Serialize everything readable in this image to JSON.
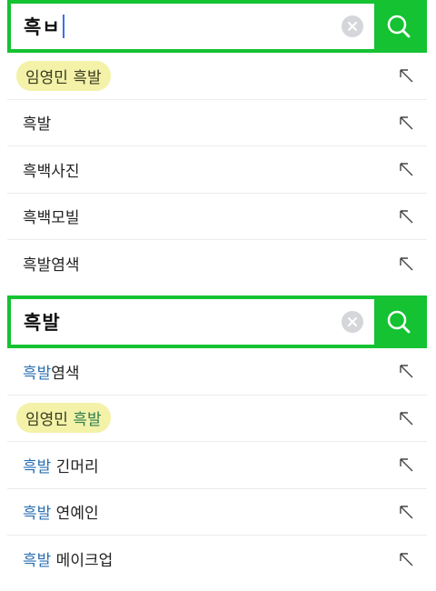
{
  "panels": [
    {
      "query": "흑ㅂ",
      "clear_icon": "close-circle-icon",
      "search_icon": "search-icon",
      "suggestions": [
        {
          "pre": "",
          "match": "",
          "rest": "임영민 흑발",
          "promoted": true
        },
        {
          "pre": "",
          "match": "",
          "rest": "흑발",
          "promoted": false
        },
        {
          "pre": "",
          "match": "",
          "rest": "흑백사진",
          "promoted": false
        },
        {
          "pre": "",
          "match": "",
          "rest": "흑백모빌",
          "promoted": false
        },
        {
          "pre": "",
          "match": "",
          "rest": "흑발염색",
          "promoted": false
        }
      ]
    },
    {
      "query": "흑발",
      "clear_icon": "close-circle-icon",
      "search_icon": "search-icon",
      "suggestions": [
        {
          "pre": "",
          "match": "흑발",
          "rest": "염색",
          "promoted": false
        },
        {
          "pre": "임영민 ",
          "match": "흑발",
          "rest": "",
          "promoted": true
        },
        {
          "pre": "",
          "match": "흑발",
          "rest": " 긴머리",
          "promoted": false
        },
        {
          "pre": "",
          "match": "흑발",
          "rest": " 연예인",
          "promoted": false
        },
        {
          "pre": "",
          "match": "흑발",
          "rest": " 메이크업",
          "promoted": false
        }
      ]
    }
  ],
  "colors": {
    "brand_green": "#14c232",
    "match_blue": "#2a6fb3",
    "promo_bg": "#f3f2a8"
  }
}
